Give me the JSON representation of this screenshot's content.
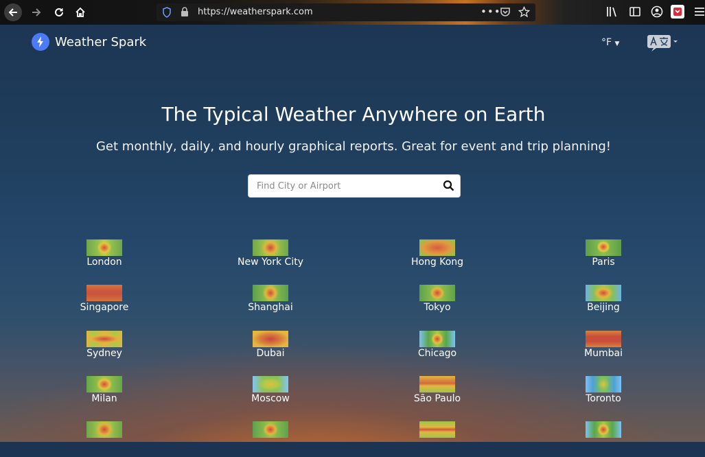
{
  "browser": {
    "url": "https://weatherspark.com"
  },
  "site": {
    "name": "Weather Spark",
    "unit_label": "°F"
  },
  "hero": {
    "title": "The Typical Weather Anywhere on Earth",
    "subtitle": "Get monthly, daily, and hourly graphical reports. Great for event and trip planning!"
  },
  "search": {
    "placeholder": "Find City or Airport",
    "value": ""
  },
  "cities": [
    {
      "name": "London"
    },
    {
      "name": "New York City"
    },
    {
      "name": "Hong Kong"
    },
    {
      "name": "Paris"
    },
    {
      "name": "Singapore"
    },
    {
      "name": "Shanghai"
    },
    {
      "name": "Tokyo"
    },
    {
      "name": "Beijing"
    },
    {
      "name": "Sydney"
    },
    {
      "name": "Dubai"
    },
    {
      "name": "Chicago"
    },
    {
      "name": "Mumbai"
    },
    {
      "name": "Milan"
    },
    {
      "name": "Moscow"
    },
    {
      "name": "São Paulo"
    },
    {
      "name": "Toronto"
    }
  ]
}
